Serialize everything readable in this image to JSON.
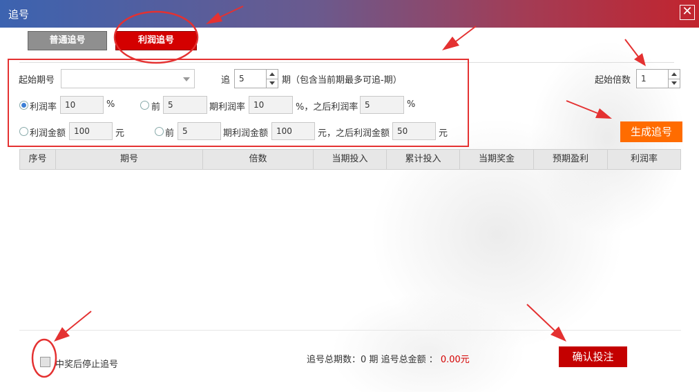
{
  "window": {
    "title": "追号",
    "close_glyph": "✕"
  },
  "tabs": [
    {
      "label": "普通追号",
      "active": false
    },
    {
      "label": "利润追号",
      "active": true
    }
  ],
  "form": {
    "start_issue_label": "起始期号",
    "start_issue_value": "",
    "chase_label": "追",
    "chase_value": "5",
    "chase_suffix": "期（包含当前期最多可追-期）",
    "start_multiple_label": "起始倍数",
    "start_multiple_value": "1",
    "row_rate": {
      "option_label": "利润率",
      "selected": true,
      "value": "10",
      "unit": "%",
      "prefix": "前",
      "periods": "5",
      "period_label": "期利润率",
      "period_value": "10",
      "after_label": "%，之后利润率",
      "after_value": "5",
      "after_unit": "%"
    },
    "row_amount": {
      "option_label": "利润金额",
      "selected": false,
      "value": "100",
      "unit": "元",
      "prefix": "前",
      "periods": "5",
      "period_label": "期利润金额",
      "period_value": "100",
      "after_label": "元，之后利润金额",
      "after_value": "50",
      "after_unit": "元"
    },
    "generate_button": "生成追号"
  },
  "table": {
    "columns": [
      "序号",
      "期号",
      "倍数",
      "当期投入",
      "累计投入",
      "当期奖金",
      "预期盈利",
      "利润率"
    ],
    "rows": []
  },
  "footer": {
    "stop_on_win_label": "中奖后停止追号",
    "stop_on_win_checked": false,
    "summary_prefix": "追号总期数：",
    "total_periods": "0",
    "summary_mid": "期 追号总金额 ：",
    "total_amount": "0.00元",
    "confirm_button": "确认投注"
  },
  "colors": {
    "accent_red": "#d40000",
    "generate_orange": "#ff6c00",
    "annotation_red": "#e43131"
  }
}
